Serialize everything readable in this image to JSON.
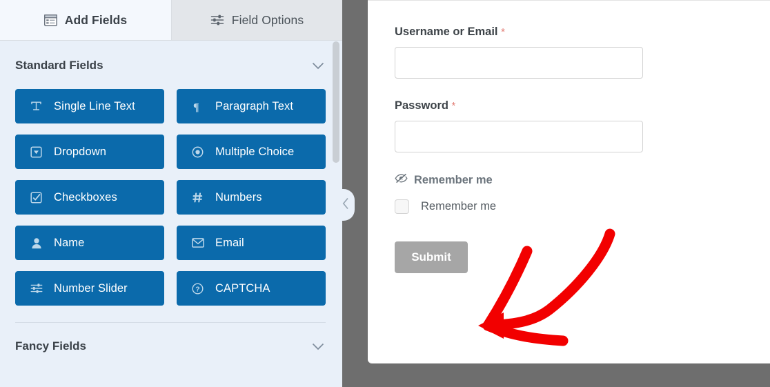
{
  "tabs": [
    {
      "label": "Add Fields",
      "icon": "form-list-icon",
      "active": true
    },
    {
      "label": "Field Options",
      "icon": "sliders-icon",
      "active": false
    }
  ],
  "sections": [
    {
      "title": "Standard Fields",
      "collapse_icon": "chevron-down-icon",
      "fields": [
        {
          "label": "Single Line Text",
          "icon": "text-cursor-icon"
        },
        {
          "label": "Paragraph Text",
          "icon": "pilcrow-icon"
        },
        {
          "label": "Dropdown",
          "icon": "dropdown-caret-icon"
        },
        {
          "label": "Multiple Choice",
          "icon": "radio-button-icon"
        },
        {
          "label": "Checkboxes",
          "icon": "checkbox-icon"
        },
        {
          "label": "Numbers",
          "icon": "hash-icon"
        },
        {
          "label": "Name",
          "icon": "user-icon"
        },
        {
          "label": "Email",
          "icon": "envelope-icon"
        },
        {
          "label": "Number Slider",
          "icon": "sliders-icon"
        },
        {
          "label": "CAPTCHA",
          "icon": "question-circle-icon"
        }
      ]
    },
    {
      "title": "Fancy Fields",
      "collapse_icon": "chevron-down-icon",
      "fields": []
    }
  ],
  "collapse_handle": {
    "icon": "chevron-left-icon"
  },
  "preview_form": {
    "fields": [
      {
        "label": "Username or Email",
        "required_marker": "*",
        "value": "",
        "placeholder": ""
      },
      {
        "label": "Password",
        "required_marker": "*",
        "value": "",
        "placeholder": ""
      }
    ],
    "remember_me": {
      "hidden_label_icon": "eye-slash-icon",
      "hidden_label_text": "Remember me",
      "checkbox_label": "Remember me",
      "checked": false
    },
    "submit_label": "Submit"
  },
  "annotation": {
    "type": "red-arrow",
    "color": "#f20000",
    "points_to": "Submit"
  },
  "colors": {
    "field_button_blue": "#0b6aab",
    "panel_background": "#e9f0f9",
    "active_tab": "#f4f8fd",
    "inactive_tab": "#e3e6ea",
    "preview_backdrop": "#6e6e6e",
    "submit_gray": "#a6a6a6",
    "required_red": "#e27c74",
    "annotation_red": "#f20000"
  }
}
